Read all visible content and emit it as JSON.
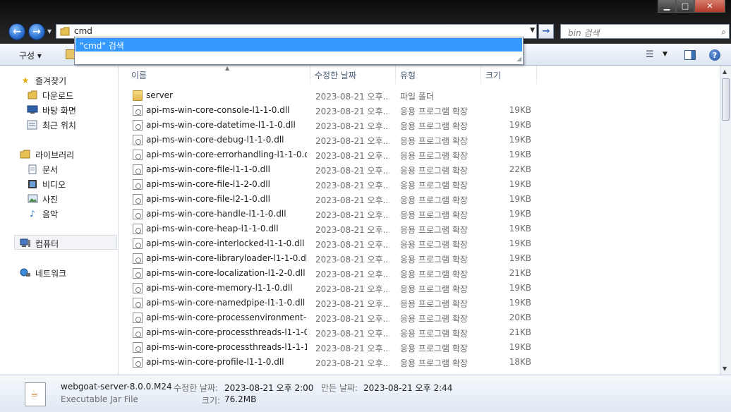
{
  "window": {
    "minimize": "▁",
    "maximize": "□",
    "close": "✕"
  },
  "nav": {
    "back": "←",
    "forward": "→",
    "address_value": "cmd",
    "go": "→",
    "search_placeholder": "bin 검색"
  },
  "autocomplete": {
    "item": "\"cmd\" 검색"
  },
  "toolbar": {
    "organize_label": "구성 ▾",
    "help": "?"
  },
  "sidebar": {
    "favorites": {
      "label": "즐겨찾기",
      "icon": "star-icon"
    },
    "favorites_items": [
      {
        "label": "다운로드",
        "icon": "folder-icon"
      },
      {
        "label": "바탕 화면",
        "icon": "desktop-icon"
      },
      {
        "label": "최근 위치",
        "icon": "recent-places-icon"
      }
    ],
    "libraries": {
      "label": "라이브러리",
      "icon": "library-icon"
    },
    "libraries_items": [
      {
        "label": "문서",
        "icon": "document-icon"
      },
      {
        "label": "비디오",
        "icon": "video-icon"
      },
      {
        "label": "사진",
        "icon": "picture-icon"
      },
      {
        "label": "음악",
        "icon": "music-icon"
      }
    ],
    "computer": {
      "label": "컴퓨터",
      "icon": "computer-icon"
    },
    "network": {
      "label": "네트워크",
      "icon": "network-icon"
    }
  },
  "columns": {
    "name": "이름",
    "date": "수정한 날짜",
    "type": "유형",
    "size": "크기"
  },
  "files": [
    {
      "name": "server",
      "date": "2023-08-21 오후...",
      "type": "파일 폴더",
      "size": "",
      "kind": "folder"
    },
    {
      "name": "api-ms-win-core-console-l1-1-0.dll",
      "date": "2023-08-21 오후...",
      "type": "응용 프로그램 확장",
      "size": "19KB",
      "kind": "dll"
    },
    {
      "name": "api-ms-win-core-datetime-l1-1-0.dll",
      "date": "2023-08-21 오후...",
      "type": "응용 프로그램 확장",
      "size": "19KB",
      "kind": "dll"
    },
    {
      "name": "api-ms-win-core-debug-l1-1-0.dll",
      "date": "2023-08-21 오후...",
      "type": "응용 프로그램 확장",
      "size": "19KB",
      "kind": "dll"
    },
    {
      "name": "api-ms-win-core-errorhandling-l1-1-0.dll",
      "date": "2023-08-21 오후...",
      "type": "응용 프로그램 확장",
      "size": "19KB",
      "kind": "dll"
    },
    {
      "name": "api-ms-win-core-file-l1-1-0.dll",
      "date": "2023-08-21 오후...",
      "type": "응용 프로그램 확장",
      "size": "22KB",
      "kind": "dll"
    },
    {
      "name": "api-ms-win-core-file-l1-2-0.dll",
      "date": "2023-08-21 오후...",
      "type": "응용 프로그램 확장",
      "size": "19KB",
      "kind": "dll"
    },
    {
      "name": "api-ms-win-core-file-l2-1-0.dll",
      "date": "2023-08-21 오후...",
      "type": "응용 프로그램 확장",
      "size": "19KB",
      "kind": "dll"
    },
    {
      "name": "api-ms-win-core-handle-l1-1-0.dll",
      "date": "2023-08-21 오후...",
      "type": "응용 프로그램 확장",
      "size": "19KB",
      "kind": "dll"
    },
    {
      "name": "api-ms-win-core-heap-l1-1-0.dll",
      "date": "2023-08-21 오후...",
      "type": "응용 프로그램 확장",
      "size": "19KB",
      "kind": "dll"
    },
    {
      "name": "api-ms-win-core-interlocked-l1-1-0.dll",
      "date": "2023-08-21 오후...",
      "type": "응용 프로그램 확장",
      "size": "19KB",
      "kind": "dll"
    },
    {
      "name": "api-ms-win-core-libraryloader-l1-1-0.dll",
      "date": "2023-08-21 오후...",
      "type": "응용 프로그램 확장",
      "size": "19KB",
      "kind": "dll"
    },
    {
      "name": "api-ms-win-core-localization-l1-2-0.dll",
      "date": "2023-08-21 오후...",
      "type": "응용 프로그램 확장",
      "size": "21KB",
      "kind": "dll"
    },
    {
      "name": "api-ms-win-core-memory-l1-1-0.dll",
      "date": "2023-08-21 오후...",
      "type": "응용 프로그램 확장",
      "size": "19KB",
      "kind": "dll"
    },
    {
      "name": "api-ms-win-core-namedpipe-l1-1-0.dll",
      "date": "2023-08-21 오후...",
      "type": "응용 프로그램 확장",
      "size": "19KB",
      "kind": "dll"
    },
    {
      "name": "api-ms-win-core-processenvironment-l1...",
      "date": "2023-08-21 오후...",
      "type": "응용 프로그램 확장",
      "size": "20KB",
      "kind": "dll"
    },
    {
      "name": "api-ms-win-core-processthreads-l1-1-0....",
      "date": "2023-08-21 오후...",
      "type": "응용 프로그램 확장",
      "size": "21KB",
      "kind": "dll"
    },
    {
      "name": "api-ms-win-core-processthreads-l1-1-1....",
      "date": "2023-08-21 오후...",
      "type": "응용 프로그램 확장",
      "size": "19KB",
      "kind": "dll"
    },
    {
      "name": "api-ms-win-core-profile-l1-1-0.dll",
      "date": "2023-08-21 오후...",
      "type": "응용 프로그램 확장",
      "size": "18KB",
      "kind": "dll"
    }
  ],
  "details": {
    "name": "webgoat-server-8.0.0.M24",
    "type": "Executable Jar File",
    "modified_label": "수정한 날짜:",
    "modified_value": "2023-08-21 오후 2:00",
    "created_label": "만든 날짜:",
    "created_value": "2023-08-21 오후 2:44",
    "size_label": "크기:",
    "size_value": "76.2MB"
  }
}
